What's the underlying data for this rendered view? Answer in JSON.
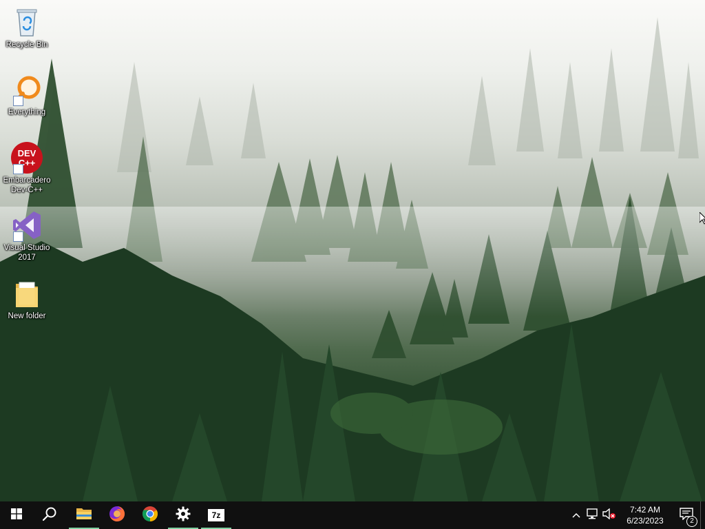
{
  "desktop": {
    "icons": [
      {
        "label": "Recycle Bin",
        "icon": "recycle-bin-icon"
      },
      {
        "label": "Everything",
        "icon": "everything-search-icon"
      },
      {
        "label": "Embarcadero Dev-C++",
        "icon": "devcpp-icon"
      },
      {
        "label": "Visual Studio 2017",
        "icon": "visual-studio-icon"
      },
      {
        "label": "New folder",
        "icon": "folder-icon"
      }
    ],
    "devcpp_logo_line1": "DEV",
    "devcpp_logo_line2": "C++"
  },
  "taskbar": {
    "buttons": [
      {
        "name": "start",
        "icon": "windows-logo-icon"
      },
      {
        "name": "search",
        "icon": "search-icon"
      },
      {
        "name": "file-explorer",
        "icon": "folder-icon",
        "state": "running"
      },
      {
        "name": "firefox",
        "icon": "firefox-icon"
      },
      {
        "name": "chrome",
        "icon": "chrome-icon"
      },
      {
        "name": "settings",
        "icon": "gear-icon",
        "state": "running"
      },
      {
        "name": "7zip",
        "icon": "7zip-icon",
        "state": "running",
        "text": "7z"
      }
    ],
    "tray": {
      "icons": [
        "chevron-up-icon",
        "network-icon",
        "volume-muted-icon"
      ],
      "time": "7:42 AM",
      "date": "6/23/2023",
      "notification_count": "2"
    }
  },
  "colors": {
    "taskbar": "#101010",
    "active_indicator": "#7fd1a2",
    "accent": "#76b9ed"
  }
}
